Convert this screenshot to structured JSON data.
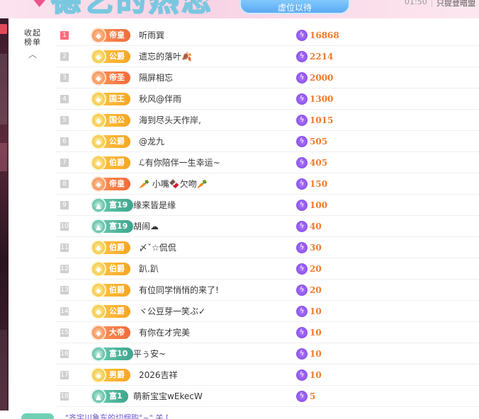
{
  "banner": {
    "title": "德艺的热恋",
    "seat_button": "虚位以待",
    "clock": "01:50",
    "notice": "只提登暗盟"
  },
  "collapse": {
    "label_line1": "收起",
    "label_line2": "榜单"
  },
  "rows": [
    {
      "rank": "1",
      "badge": "帝皇",
      "tone": "orange",
      "name": "听雨巽",
      "score": "16868"
    },
    {
      "rank": "2",
      "badge": "公爵",
      "tone": "gold",
      "name": "遗忘的落叶🍂",
      "score": "2214"
    },
    {
      "rank": "3",
      "badge": "帝圣",
      "tone": "orange",
      "name": "隔屏相忘",
      "score": "2000"
    },
    {
      "rank": "4",
      "badge": "国王",
      "tone": "gold",
      "name": "秋风@伴雨",
      "score": "1300"
    },
    {
      "rank": "5",
      "badge": "国公",
      "tone": "gold",
      "name": "海到尽头天作岸,",
      "score": "1015"
    },
    {
      "rank": "6",
      "badge": "公爵",
      "tone": "gold",
      "name": "@龙九",
      "score": "505"
    },
    {
      "rank": "7",
      "badge": "伯爵",
      "tone": "gold",
      "name": "ℒ有你陪伴一生幸运~",
      "score": "405"
    },
    {
      "rank": "8",
      "badge": "帝皇",
      "tone": "orange",
      "name": "🥕 小嘴🍫欠吻🥕",
      "score": "150"
    },
    {
      "rank": "9",
      "badge": "富19",
      "tone": "teal",
      "name": "缘来皆是缘",
      "score": "100"
    },
    {
      "rank": "10",
      "badge": "富19",
      "tone": "teal",
      "name": "胡闹☁",
      "score": "40"
    },
    {
      "rank": "11",
      "badge": "伯爵",
      "tone": "gold",
      "name": "〆ˇ☆侃侃",
      "score": "30"
    },
    {
      "rank": "12",
      "badge": "伯爵",
      "tone": "gold",
      "name": "趴.趴",
      "score": "20"
    },
    {
      "rank": "13",
      "badge": "伯爵",
      "tone": "gold",
      "name": "有位同学悄悄的来了!",
      "score": "20"
    },
    {
      "rank": "14",
      "badge": "公爵",
      "tone": "gold",
      "name": "ヾ公豆芽一笑ぶ✓",
      "score": "10"
    },
    {
      "rank": "15",
      "badge": "大帝",
      "tone": "orange",
      "name": "有你在才完美",
      "score": "10"
    },
    {
      "rank": "16",
      "badge": "富10",
      "tone": "teal",
      "name": "平ぅ安~",
      "score": "10"
    },
    {
      "rank": "17",
      "badge": "男爵",
      "tone": "gold",
      "name": "2026吉祥",
      "score": "10"
    },
    {
      "rank": "18",
      "badge": "富1",
      "tone": "teal",
      "name": "萌新宝宝wEkecW",
      "score": "5"
    }
  ],
  "bottom_chat": {
    "text": "\"齐宇川鲁东的切烟购°~\" 关 ["
  },
  "colors": {
    "score": "#f07a2a",
    "bolt": "#7b3fe0",
    "gold_badge": "#f5a623",
    "orange_badge": "#f26a3a",
    "teal_badge": "#3ea58c",
    "rank_top": "#ff6b7a",
    "rank_other": "#cfcfcf"
  },
  "icons": {
    "collapse": "chevron-up-icon",
    "score": "lightning-bolt-icon",
    "badge": "rank-medal-icon",
    "banner": "heart-icon"
  }
}
